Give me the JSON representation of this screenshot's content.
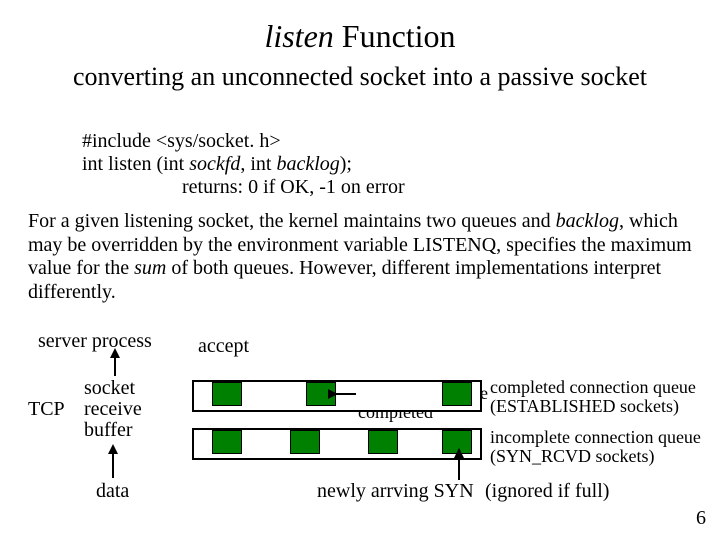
{
  "title_italic": "listen",
  "title_rest": " Function",
  "subtitle": "converting an unconnected socket into a passive socket",
  "code": {
    "include": "#include <sys/socket. h>",
    "sig_pre": "int listen (int ",
    "sig_a1": "sockfd",
    "sig_mid": ", int ",
    "sig_a2": "backlog",
    "sig_post": ");",
    "returns": "returns: 0 if OK, -1 on error"
  },
  "para": {
    "p1a": "For a given listening socket, the kernel maintains two queues and ",
    "p1_it1": "backlog",
    "p1b": ", which may be overridden by the environment variable LISTENQ, specifies the maximum value for the ",
    "p1_it2": "sum",
    "p1c": " of both queues. However, different implementations interpret differently."
  },
  "labels": {
    "server_process": "server process",
    "accept": "accept",
    "tcp": "TCP",
    "srb1": "socket",
    "srb2": "receive",
    "srb3": "buffer",
    "data": "data",
    "hs1": "3 -way handshake",
    "hs2": "completed",
    "ccq1": "completed connection queue",
    "ccq2": "(ESTABLISHED sockets)",
    "icq1": "incomplete connection queue",
    "icq2": "(SYN_RCVD sockets)",
    "newsyn": "newly arrving SYN",
    "ignored": "(ignored if full)",
    "pagenum": "6"
  }
}
